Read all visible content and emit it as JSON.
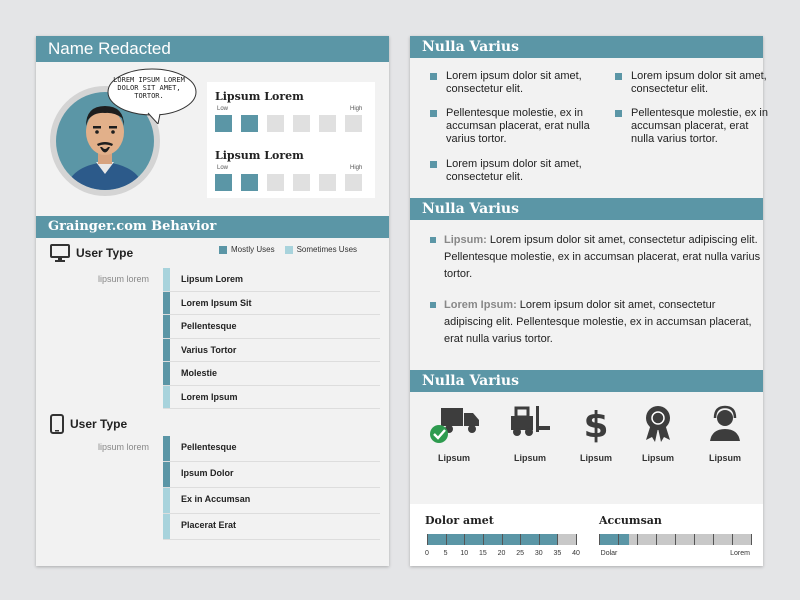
{
  "left": {
    "name_title": "Name Redacted",
    "speech": "LOREM IPSUM LOREM DOLOR SIT AMET, TORTOR.",
    "ratings": [
      {
        "title": "Lipsum Lorem",
        "low": "Low",
        "high": "High",
        "level": 2,
        "max": 6
      },
      {
        "title": "Lipsum Lorem",
        "low": "Low",
        "high": "High",
        "level": 2,
        "max": 6
      }
    ],
    "behavior_title": "Grainger.com Behavior",
    "legend": {
      "most": "Mostly Uses",
      "some": "Sometimes Uses"
    },
    "desktop": {
      "heading": "User Type",
      "row_label": "lipsum lorem",
      "items": [
        {
          "label": "Lipsum Lorem",
          "usage": "some"
        },
        {
          "label": "Lorem Ipsum Sit",
          "usage": "most"
        },
        {
          "label": "Pellentesque",
          "usage": "most"
        },
        {
          "label": "Varius Tortor",
          "usage": "most"
        },
        {
          "label": "Molestie",
          "usage": "most"
        },
        {
          "label": "Lorem Ipsum",
          "usage": "some"
        }
      ]
    },
    "mobile": {
      "heading": "User Type",
      "row_label": "lipsum lorem",
      "items": [
        {
          "label": "Pellentesque",
          "usage": "most"
        },
        {
          "label": "Ipsum Dolor",
          "usage": "most"
        },
        {
          "label": "Ex in Accumsan",
          "usage": "some"
        },
        {
          "label": "Placerat Erat",
          "usage": "some"
        }
      ]
    }
  },
  "right": {
    "section1": {
      "title": "Nulla Varius",
      "col1": [
        "Lorem ipsum dolor sit amet, consectetur elit.",
        "Pellentesque molestie, ex in accumsan placerat, erat nulla varius tortor.",
        "Lorem ipsum dolor sit amet, consectetur elit."
      ],
      "col2": [
        "Lorem ipsum dolor sit amet, consectetur elit.",
        "Pellentesque molestie, ex in accumsan placerat, erat nulla varius tortor."
      ]
    },
    "section2": {
      "title": "Nulla Varius",
      "paras": [
        {
          "lead": "Lipsum:",
          "text": " Lorem ipsum dolor sit amet, consectetur adipiscing elit. Pellentesque molestie, ex in accumsan placerat, erat nulla varius tortor."
        },
        {
          "lead": "Lorem Ipsum:",
          "text": " Lorem ipsum dolor sit amet, consectetur adipiscing elit. Pellentesque molestie, ex in accumsan placerat, erat nulla varius tortor."
        }
      ]
    },
    "section3": {
      "title": "Nulla Varius",
      "icons": [
        {
          "icon": "truck-icon",
          "label": "Lipsum",
          "checked": true
        },
        {
          "icon": "forklift-icon",
          "label": "Lipsum"
        },
        {
          "icon": "dollar-icon",
          "label": "Lipsum"
        },
        {
          "icon": "award-ribbon-icon",
          "label": "Lipsum"
        },
        {
          "icon": "headset-person-icon",
          "label": "Lipsum"
        }
      ]
    },
    "dolor": {
      "title": "Dolor amet",
      "ticks": [
        "0",
        "5",
        "10",
        "15",
        "20",
        "25",
        "30",
        "35",
        "40"
      ],
      "value": 35,
      "max": 40
    },
    "accumsan": {
      "title": "Accumsan",
      "left_label": "Dolar",
      "right_label": "Lorem",
      "value": 0.2
    },
    "colors": {
      "accent": "#5b96a6",
      "light": "#a8d3dc",
      "check": "#2e9b4f"
    }
  }
}
